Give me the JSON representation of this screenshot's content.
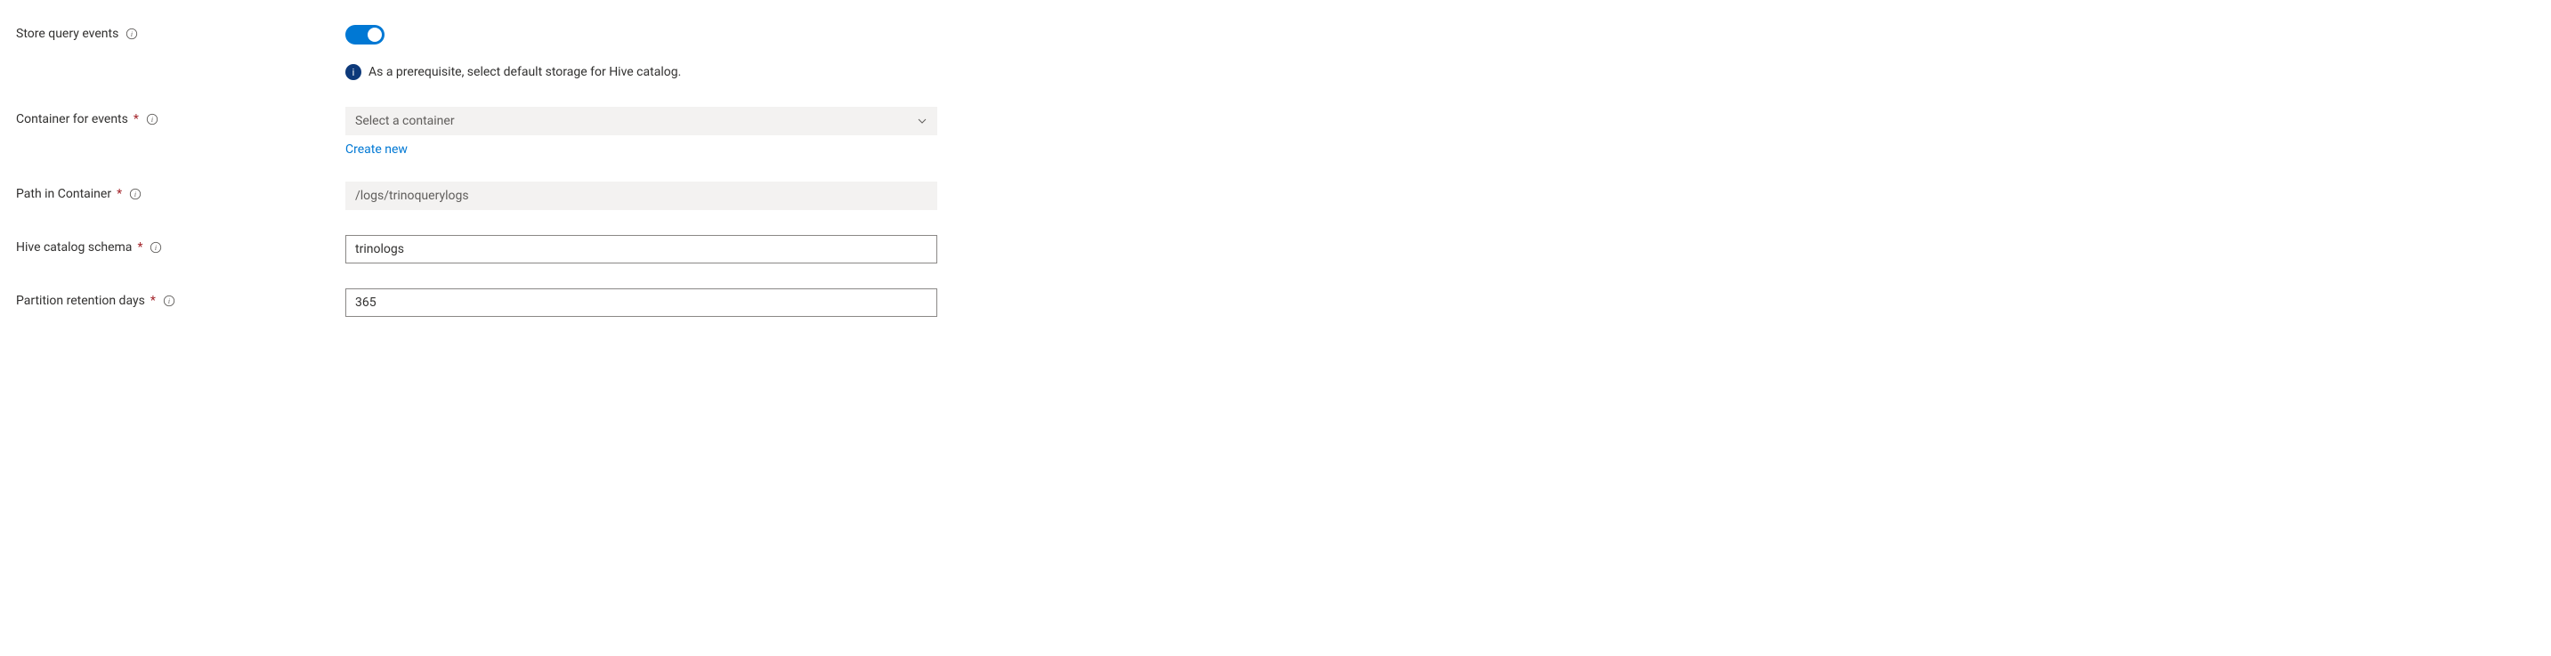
{
  "store_events": {
    "label": "Store query events",
    "toggled": true,
    "note_text": "As a prerequisite, select default storage for Hive catalog."
  },
  "container_for_events": {
    "label": "Container for events",
    "placeholder": "Select a container",
    "create_new": "Create new"
  },
  "path_in_container": {
    "label": "Path in Container",
    "placeholder": "/logs/trinoquerylogs"
  },
  "hive_schema": {
    "label": "Hive catalog schema",
    "value": "trinologs"
  },
  "retention": {
    "label": "Partition retention days",
    "value": "365"
  }
}
